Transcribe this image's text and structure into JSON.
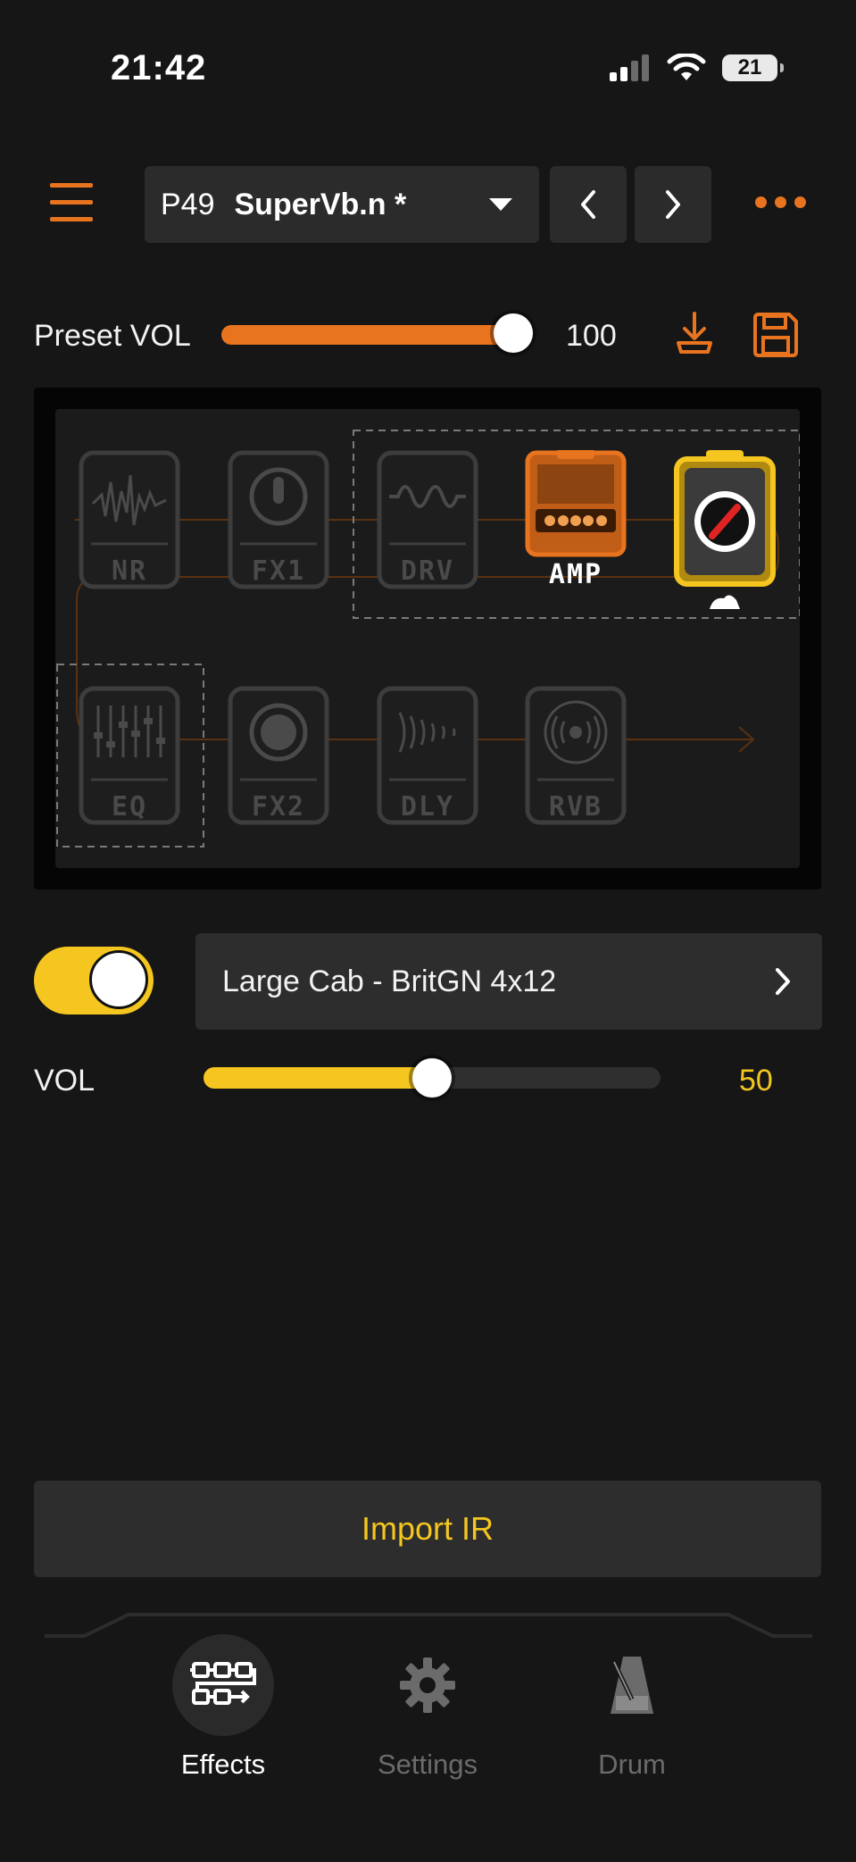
{
  "status_bar": {
    "time": "21:42",
    "battery": "21"
  },
  "header": {
    "preset_number": "P49",
    "preset_name": "SuperVb.n *"
  },
  "preset_volume": {
    "label": "Preset VOL",
    "value": "100",
    "level": 1.0
  },
  "chain": {
    "blocks": [
      {
        "id": "nr",
        "label": "NR",
        "active": false
      },
      {
        "id": "fx1",
        "label": "FX1",
        "active": false
      },
      {
        "id": "drv",
        "label": "DRV",
        "active": false
      },
      {
        "id": "amp",
        "label": "AMP",
        "active": true
      },
      {
        "id": "cab",
        "label": "",
        "active": true,
        "selected": true
      },
      {
        "id": "eq",
        "label": "EQ",
        "active": false
      },
      {
        "id": "fx2",
        "label": "FX2",
        "active": false
      },
      {
        "id": "dly",
        "label": "DLY",
        "active": false
      },
      {
        "id": "rvb",
        "label": "RVB",
        "active": false
      }
    ]
  },
  "cab": {
    "enabled": true,
    "name": "Large Cab - BritGN 4x12",
    "vol_label": "VOL",
    "vol_value": "50",
    "vol_level": 0.5
  },
  "import_button": "Import IR",
  "bottom_nav": [
    {
      "label": "Effects",
      "icon": "effects-chain-icon",
      "active": true
    },
    {
      "label": "Settings",
      "icon": "gear-icon",
      "active": false
    },
    {
      "label": "Drum",
      "icon": "metronome-icon",
      "active": false
    }
  ],
  "colors": {
    "accent_orange": "#e8741f",
    "accent_yellow": "#f4c61f",
    "background": "#161616"
  }
}
